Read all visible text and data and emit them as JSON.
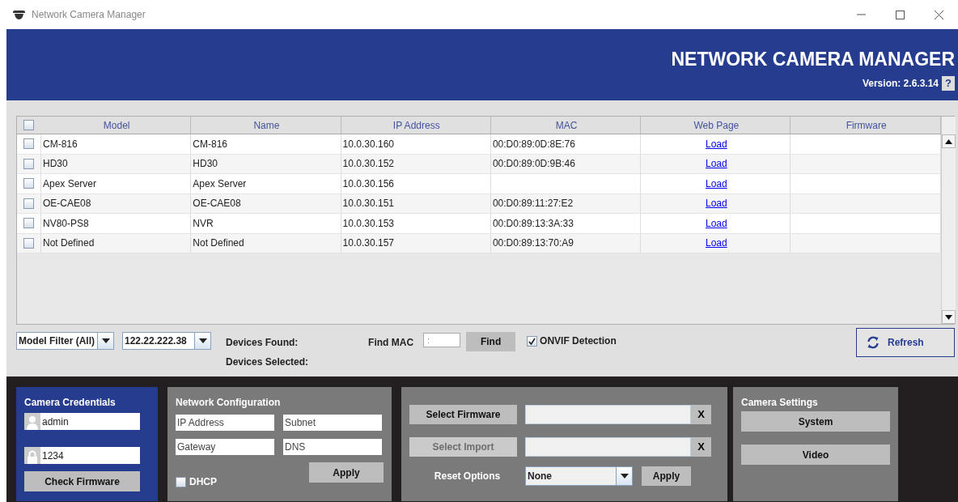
{
  "window": {
    "title": "Network Camera Manager"
  },
  "header": {
    "title": "NETWORK CAMERA MANAGER",
    "version": "Version: 2.6.3.14",
    "help": "?"
  },
  "table": {
    "select_all_checked": false,
    "columns": [
      "Model",
      "Name",
      "IP Address",
      "MAC",
      "Web Page",
      "Firmware"
    ],
    "rows": [
      {
        "checked": false,
        "model": "CM-816",
        "name": "CM-816",
        "ip": "10.0.30.160",
        "mac": "00:D0:89:0D:8E:76",
        "web_page": "Load"
      },
      {
        "checked": false,
        "model": "HD30",
        "name": "HD30",
        "ip": "10.0.30.152",
        "mac": "00:D0:89:0D:9B:46",
        "web_page": "Load"
      },
      {
        "checked": false,
        "model": "Apex Server",
        "name": "Apex Server",
        "ip": "10.0.30.156",
        "web_page": "Load"
      },
      {
        "checked": false,
        "model": "OE-CAE08",
        "name": "OE-CAE08",
        "ip": "10.0.30.151",
        "mac": "00:D0:89:11:27:E2",
        "web_page": "Load"
      },
      {
        "checked": false,
        "model": "NV80-PS8",
        "name": "NVR",
        "ip": "10.0.30.153",
        "mac": "00:D0:89:13:3A:33",
        "web_page": "Load"
      },
      {
        "checked": false,
        "model": "Not Defined",
        "name": "Not Defined",
        "ip": "10.0.30.157",
        "mac": "00:D0:89:13:70:A9",
        "web_page": "Load"
      }
    ]
  },
  "toolbar": {
    "model_filter": "Model Filter (All)",
    "ip_select": "122.22.222.38",
    "devices_found": "Devices Found:",
    "devices_selected": "Devices Selected:",
    "find_mac_label": "Find MAC",
    "find_mac_value": ":",
    "find_button": "Find",
    "onvif": {
      "label": "ONVIF Detection",
      "checked": true
    },
    "refresh": "Refresh"
  },
  "credentials": {
    "title": "Camera Credentials",
    "username": "admin",
    "password": "1234",
    "button": "Check Firmware"
  },
  "network": {
    "title": "Network Configuration",
    "fields": [
      {
        "placeholder": "IP Address"
      },
      {
        "placeholder": "Subnet"
      },
      {
        "placeholder": "Gateway"
      },
      {
        "placeholder": "DNS"
      }
    ],
    "apply": "Apply",
    "dhcp": {
      "label": "DHCP",
      "checked": false
    }
  },
  "firmware": {
    "actions": [
      {
        "label": "Select Firmware",
        "disabled": false,
        "clear": "X"
      },
      {
        "label": "Select Import",
        "disabled": true,
        "clear": "X"
      }
    ],
    "reset_label": "Reset Options",
    "reset_value": "None",
    "apply": "Apply"
  },
  "camera_settings": {
    "title": "Camera Settings",
    "buttons": [
      "System",
      "Video"
    ]
  }
}
